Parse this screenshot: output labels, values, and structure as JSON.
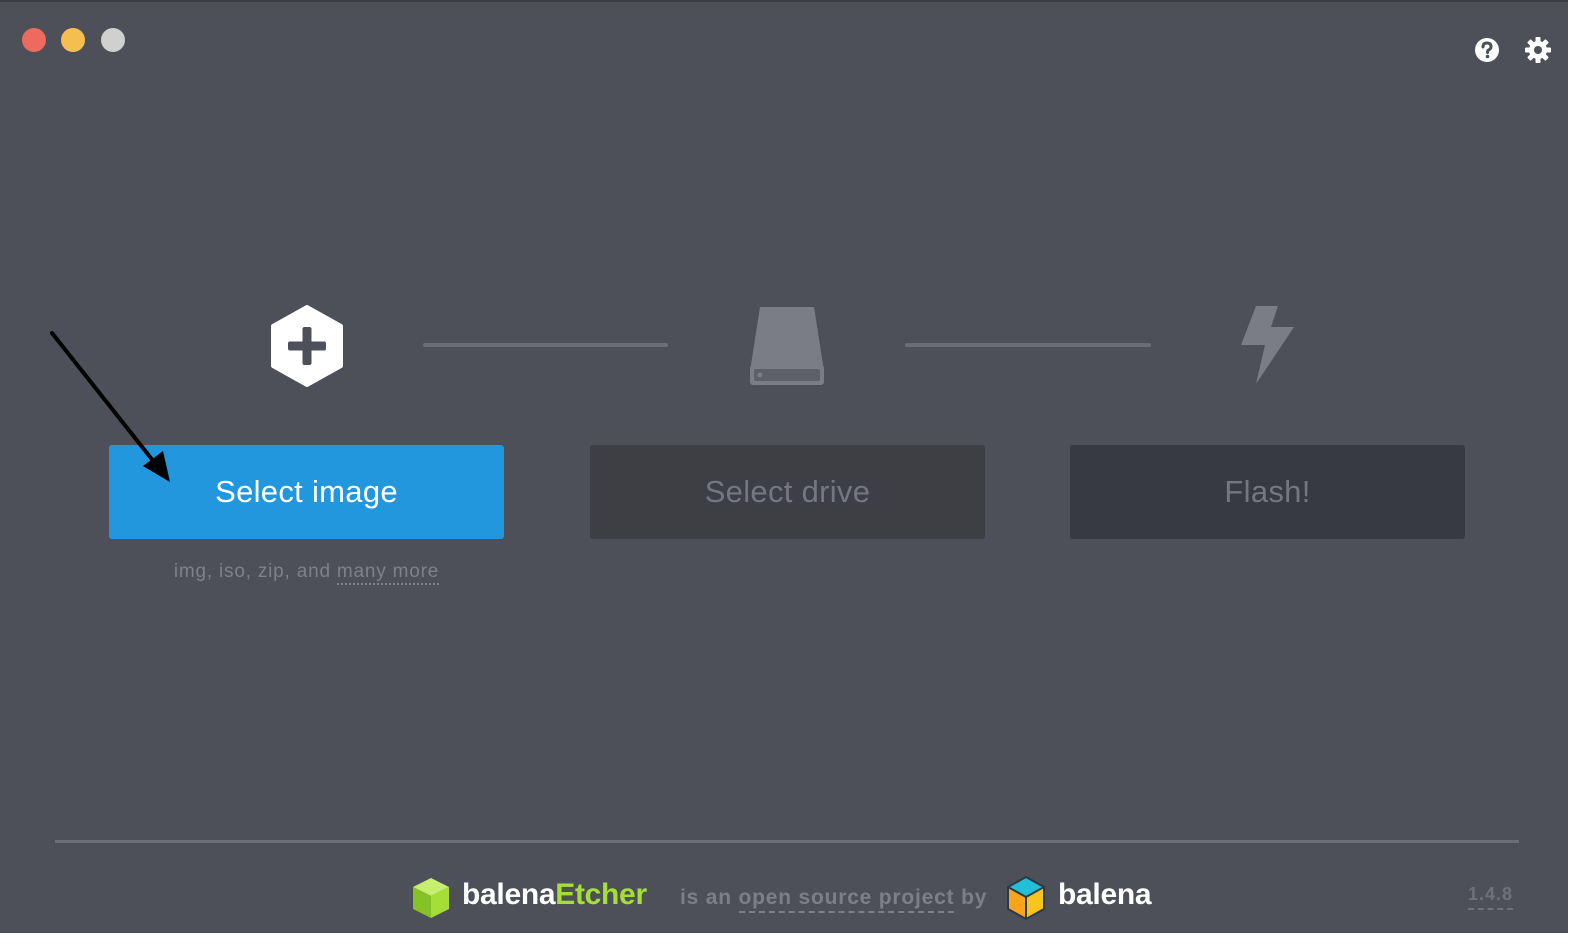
{
  "app": {
    "name": "balenaEtcher",
    "colors": {
      "background": "#4d5059",
      "accent_blue": "#2297de",
      "etcher_green": "#a5de37",
      "disabled_button": "#3d3f45",
      "disabled_text": "#74777f"
    }
  },
  "window_controls": [
    {
      "name": "close",
      "color": "#ed6a5e"
    },
    {
      "name": "minimize",
      "color": "#f5bf4f"
    },
    {
      "name": "maximize",
      "color": "#d0d0d0"
    }
  ],
  "toolbar": {
    "help_icon": "question-circle-icon",
    "settings_icon": "gear-icon"
  },
  "steps": [
    {
      "icon": "hexagon-plus-icon",
      "button_label": "Select image",
      "enabled": true
    },
    {
      "icon": "drive-icon",
      "button_label": "Select drive",
      "enabled": false
    },
    {
      "icon": "lightning-bolt-icon",
      "button_label": "Flash!",
      "enabled": false
    }
  ],
  "image_formats": {
    "text": "img, iso, zip, and",
    "more_link": "many more"
  },
  "footer": {
    "brand_prefix": "balena",
    "brand_accent": "Etcher",
    "tagline_prefix": "is an",
    "tagline_link": "open source project",
    "tagline_suffix": "by",
    "company": "balena",
    "version": "1.4.8"
  }
}
